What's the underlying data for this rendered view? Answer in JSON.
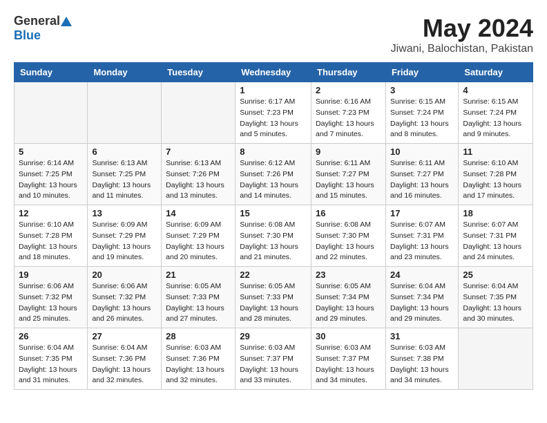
{
  "header": {
    "logo_general": "General",
    "logo_blue": "Blue",
    "title": "May 2024",
    "location": "Jiwani, Balochistan, Pakistan"
  },
  "weekdays": [
    "Sunday",
    "Monday",
    "Tuesday",
    "Wednesday",
    "Thursday",
    "Friday",
    "Saturday"
  ],
  "weeks": [
    [
      {
        "day": "",
        "info": ""
      },
      {
        "day": "",
        "info": ""
      },
      {
        "day": "",
        "info": ""
      },
      {
        "day": "1",
        "info": "Sunrise: 6:17 AM\nSunset: 7:23 PM\nDaylight: 13 hours\nand 5 minutes."
      },
      {
        "day": "2",
        "info": "Sunrise: 6:16 AM\nSunset: 7:23 PM\nDaylight: 13 hours\nand 7 minutes."
      },
      {
        "day": "3",
        "info": "Sunrise: 6:15 AM\nSunset: 7:24 PM\nDaylight: 13 hours\nand 8 minutes."
      },
      {
        "day": "4",
        "info": "Sunrise: 6:15 AM\nSunset: 7:24 PM\nDaylight: 13 hours\nand 9 minutes."
      }
    ],
    [
      {
        "day": "5",
        "info": "Sunrise: 6:14 AM\nSunset: 7:25 PM\nDaylight: 13 hours\nand 10 minutes."
      },
      {
        "day": "6",
        "info": "Sunrise: 6:13 AM\nSunset: 7:25 PM\nDaylight: 13 hours\nand 11 minutes."
      },
      {
        "day": "7",
        "info": "Sunrise: 6:13 AM\nSunset: 7:26 PM\nDaylight: 13 hours\nand 13 minutes."
      },
      {
        "day": "8",
        "info": "Sunrise: 6:12 AM\nSunset: 7:26 PM\nDaylight: 13 hours\nand 14 minutes."
      },
      {
        "day": "9",
        "info": "Sunrise: 6:11 AM\nSunset: 7:27 PM\nDaylight: 13 hours\nand 15 minutes."
      },
      {
        "day": "10",
        "info": "Sunrise: 6:11 AM\nSunset: 7:27 PM\nDaylight: 13 hours\nand 16 minutes."
      },
      {
        "day": "11",
        "info": "Sunrise: 6:10 AM\nSunset: 7:28 PM\nDaylight: 13 hours\nand 17 minutes."
      }
    ],
    [
      {
        "day": "12",
        "info": "Sunrise: 6:10 AM\nSunset: 7:28 PM\nDaylight: 13 hours\nand 18 minutes."
      },
      {
        "day": "13",
        "info": "Sunrise: 6:09 AM\nSunset: 7:29 PM\nDaylight: 13 hours\nand 19 minutes."
      },
      {
        "day": "14",
        "info": "Sunrise: 6:09 AM\nSunset: 7:29 PM\nDaylight: 13 hours\nand 20 minutes."
      },
      {
        "day": "15",
        "info": "Sunrise: 6:08 AM\nSunset: 7:30 PM\nDaylight: 13 hours\nand 21 minutes."
      },
      {
        "day": "16",
        "info": "Sunrise: 6:08 AM\nSunset: 7:30 PM\nDaylight: 13 hours\nand 22 minutes."
      },
      {
        "day": "17",
        "info": "Sunrise: 6:07 AM\nSunset: 7:31 PM\nDaylight: 13 hours\nand 23 minutes."
      },
      {
        "day": "18",
        "info": "Sunrise: 6:07 AM\nSunset: 7:31 PM\nDaylight: 13 hours\nand 24 minutes."
      }
    ],
    [
      {
        "day": "19",
        "info": "Sunrise: 6:06 AM\nSunset: 7:32 PM\nDaylight: 13 hours\nand 25 minutes."
      },
      {
        "day": "20",
        "info": "Sunrise: 6:06 AM\nSunset: 7:32 PM\nDaylight: 13 hours\nand 26 minutes."
      },
      {
        "day": "21",
        "info": "Sunrise: 6:05 AM\nSunset: 7:33 PM\nDaylight: 13 hours\nand 27 minutes."
      },
      {
        "day": "22",
        "info": "Sunrise: 6:05 AM\nSunset: 7:33 PM\nDaylight: 13 hours\nand 28 minutes."
      },
      {
        "day": "23",
        "info": "Sunrise: 6:05 AM\nSunset: 7:34 PM\nDaylight: 13 hours\nand 29 minutes."
      },
      {
        "day": "24",
        "info": "Sunrise: 6:04 AM\nSunset: 7:34 PM\nDaylight: 13 hours\nand 29 minutes."
      },
      {
        "day": "25",
        "info": "Sunrise: 6:04 AM\nSunset: 7:35 PM\nDaylight: 13 hours\nand 30 minutes."
      }
    ],
    [
      {
        "day": "26",
        "info": "Sunrise: 6:04 AM\nSunset: 7:35 PM\nDaylight: 13 hours\nand 31 minutes."
      },
      {
        "day": "27",
        "info": "Sunrise: 6:04 AM\nSunset: 7:36 PM\nDaylight: 13 hours\nand 32 minutes."
      },
      {
        "day": "28",
        "info": "Sunrise: 6:03 AM\nSunset: 7:36 PM\nDaylight: 13 hours\nand 32 minutes."
      },
      {
        "day": "29",
        "info": "Sunrise: 6:03 AM\nSunset: 7:37 PM\nDaylight: 13 hours\nand 33 minutes."
      },
      {
        "day": "30",
        "info": "Sunrise: 6:03 AM\nSunset: 7:37 PM\nDaylight: 13 hours\nand 34 minutes."
      },
      {
        "day": "31",
        "info": "Sunrise: 6:03 AM\nSunset: 7:38 PM\nDaylight: 13 hours\nand 34 minutes."
      },
      {
        "day": "",
        "info": ""
      }
    ]
  ]
}
